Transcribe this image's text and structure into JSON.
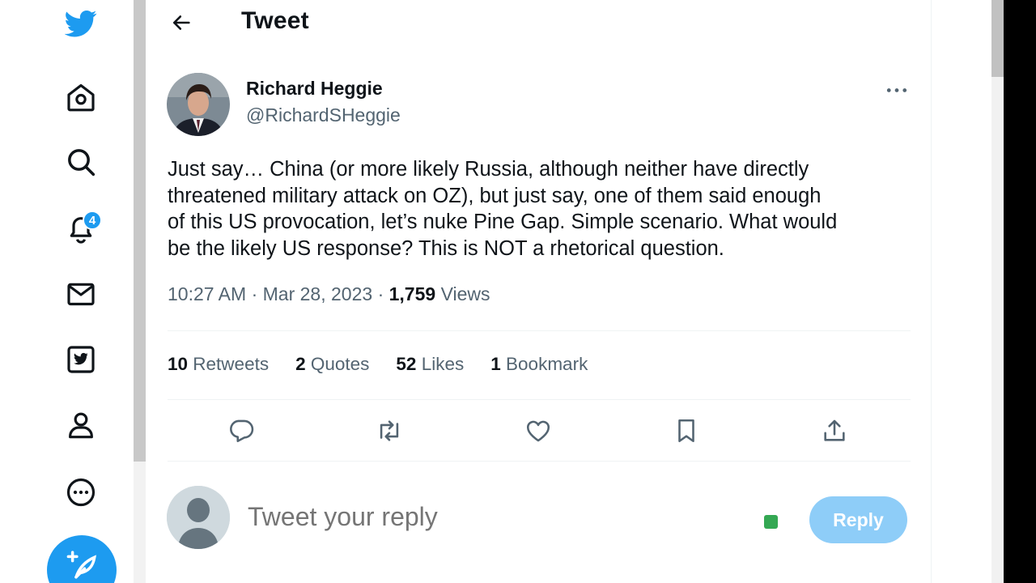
{
  "header": {
    "title": "Tweet"
  },
  "nav": {
    "notifications_badge": "4"
  },
  "tweet": {
    "author_name": "Richard Heggie",
    "author_handle": "@RichardSHeggie",
    "text": "Just say… China (or more likely Russia, although neither have directly\nthreatened military attack on OZ), but just say, one of them said enough\nof this US provocation, let’s nuke Pine Gap. Simple scenario. What would\nbe the likely US response? This is NOT a rhetorical question.",
    "time": "10:27 AM",
    "date": "Mar 28, 2023",
    "views_count": "1,759",
    "views_label": "Views",
    "sep": "·"
  },
  "stats": {
    "retweets_count": "10",
    "retweets_label": "Retweets",
    "quotes_count": "2",
    "quotes_label": "Quotes",
    "likes_count": "52",
    "likes_label": "Likes",
    "bookmarks_count": "1",
    "bookmarks_label": "Bookmark"
  },
  "reply": {
    "placeholder": "Tweet your reply",
    "button_label": "Reply"
  },
  "colors": {
    "accent": "#1d9bf0",
    "reply_button_disabled": "#8ecdf8",
    "secondary_text": "#536471",
    "primary_text": "#0f1419"
  },
  "icons": [
    "twitter-logo-icon",
    "home-icon",
    "search-icon",
    "notifications-icon",
    "messages-icon",
    "twitter-blue-icon",
    "profile-icon",
    "more-circle-icon",
    "compose-icon",
    "back-arrow-icon",
    "more-dots-icon",
    "reply-icon",
    "retweet-icon",
    "like-icon",
    "bookmark-icon",
    "share-icon"
  ]
}
